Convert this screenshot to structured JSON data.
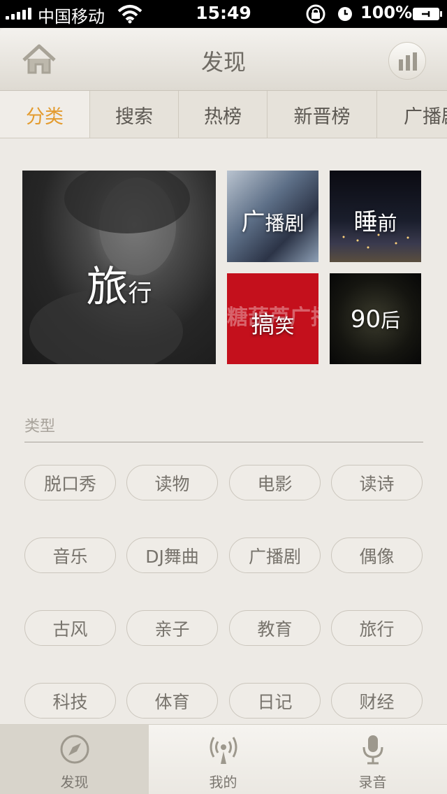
{
  "status_bar": {
    "carrier": "中国移动",
    "time": "15:49",
    "battery": "100%"
  },
  "navbar": {
    "title": "发现"
  },
  "tabs": [
    {
      "label": "分类",
      "active": true
    },
    {
      "label": "搜索",
      "active": false
    },
    {
      "label": "热榜",
      "active": false
    },
    {
      "label": "新晋榜",
      "active": false
    },
    {
      "label": "广播剧",
      "active": false
    }
  ],
  "featured": {
    "travel": {
      "big": "旅",
      "small": "行"
    },
    "drama": {
      "big": "广",
      "small": "播剧"
    },
    "sleep": {
      "big": "睡",
      "small": "前"
    },
    "funny": {
      "big": "搞",
      "small": "笑",
      "bg": "糖葫芦广播"
    },
    "nineties": {
      "big": "90",
      "small": "后"
    }
  },
  "category": {
    "title": "类型",
    "chips": [
      "脱口秀",
      "读物",
      "电影",
      "读诗",
      "音乐",
      "DJ舞曲",
      "广播剧",
      "偶像",
      "古风",
      "亲子",
      "教育",
      "旅行",
      "科技",
      "体育",
      "日记",
      "财经"
    ]
  },
  "tabbar": {
    "items": [
      {
        "label": "发现",
        "icon": "compass-icon",
        "active": true
      },
      {
        "label": "我的",
        "icon": "broadcast-icon",
        "active": false
      },
      {
        "label": "录音",
        "icon": "microphone-icon",
        "active": false
      }
    ]
  },
  "colors": {
    "accent": "#e39b2e",
    "background": "#edeae5",
    "chip_text": "#77736c"
  }
}
